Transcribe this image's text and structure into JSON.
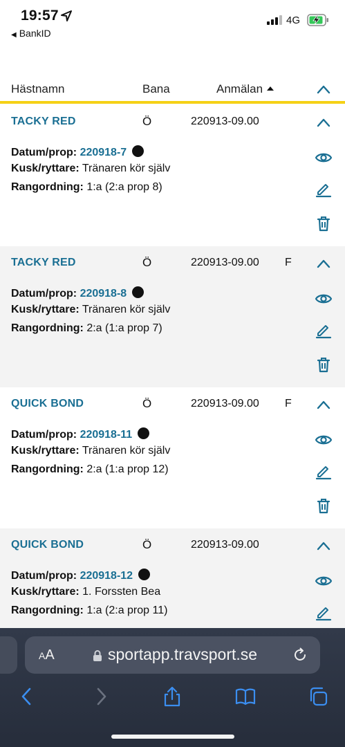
{
  "status_bar": {
    "time": "19:57",
    "back_app": "BankID",
    "network": "4G",
    "icons": [
      "location-arrow-icon",
      "signal-icon",
      "battery-charging-icon"
    ]
  },
  "table": {
    "headers": {
      "name": "Hästnamn",
      "bana": "Bana",
      "anmalan": "Anmälan"
    },
    "accent_color": "#f5d116",
    "link_color": "#1a6f93",
    "rows": [
      {
        "horse": "TACKY RED",
        "bana": "Ö",
        "anmalan": "220913-09.00",
        "flag": "",
        "datum_label": "Datum/prop:",
        "datum_value": "220918-7",
        "kusk_label": "Kusk/ryttare:",
        "kusk_value": "Tränaren kör själv",
        "rang_label": "Rangordning:",
        "rang_value": "1:a (2:a prop 8)"
      },
      {
        "horse": "TACKY RED",
        "bana": "Ö",
        "anmalan": "220913-09.00",
        "flag": "F",
        "datum_label": "Datum/prop:",
        "datum_value": "220918-8",
        "kusk_label": "Kusk/ryttare:",
        "kusk_value": "Tränaren kör själv",
        "rang_label": "Rangordning:",
        "rang_value": "2:a (1:a prop 7)"
      },
      {
        "horse": "QUICK BOND",
        "bana": "Ö",
        "anmalan": "220913-09.00",
        "flag": "F",
        "datum_label": "Datum/prop:",
        "datum_value": "220918-11",
        "kusk_label": "Kusk/ryttare:",
        "kusk_value": "Tränaren kör själv",
        "rang_label": "Rangordning:",
        "rang_value": "2:a (1:a prop 12)"
      },
      {
        "horse": "QUICK BOND",
        "bana": "Ö",
        "anmalan": "220913-09.00",
        "flag": "",
        "datum_label": "Datum/prop:",
        "datum_value": "220918-12",
        "kusk_label": "Kusk/ryttare:",
        "kusk_value": "1. Forssten Bea",
        "rang_label": "Rangordning:",
        "rang_value": "1:a (2:a prop 11)"
      }
    ]
  },
  "safari": {
    "aa": "AA",
    "url": "sportapp.travsport.se",
    "toolbar_icons": [
      "back-icon",
      "forward-icon",
      "share-icon",
      "bookmarks-icon",
      "tabs-icon"
    ]
  }
}
